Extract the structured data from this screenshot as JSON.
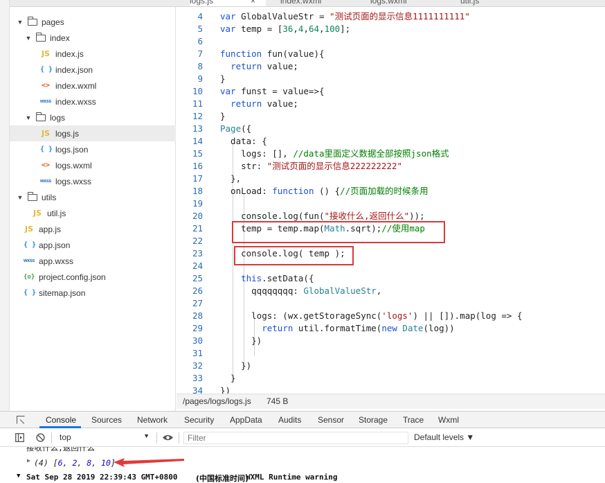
{
  "tabs": [
    {
      "label": "logs.js",
      "active": true,
      "close": "×"
    },
    {
      "label": "index.wxml",
      "active": false
    },
    {
      "label": "logs.wxml",
      "active": false
    },
    {
      "label": "util.js",
      "active": false
    }
  ],
  "tree": [
    {
      "type": "folder",
      "label": "pages",
      "expanded": true,
      "depth": 0
    },
    {
      "type": "folder",
      "label": "index",
      "expanded": true,
      "depth": 1
    },
    {
      "type": "js",
      "label": "index.js",
      "depth": 2
    },
    {
      "type": "json",
      "label": "index.json",
      "depth": 2
    },
    {
      "type": "wxml",
      "label": "index.wxml",
      "depth": 2
    },
    {
      "type": "wxss",
      "label": "index.wxss",
      "depth": 2
    },
    {
      "type": "folder",
      "label": "logs",
      "expanded": true,
      "depth": 1
    },
    {
      "type": "js",
      "label": "logs.js",
      "depth": 2,
      "selected": true
    },
    {
      "type": "json",
      "label": "logs.json",
      "depth": 2
    },
    {
      "type": "wxml",
      "label": "logs.wxml",
      "depth": 2
    },
    {
      "type": "wxss",
      "label": "logs.wxss",
      "depth": 2
    },
    {
      "type": "folder",
      "label": "utils",
      "expanded": true,
      "depth": 0
    },
    {
      "type": "js",
      "label": "util.js",
      "depth": 1
    },
    {
      "type": "js",
      "label": "app.js",
      "depth": 0
    },
    {
      "type": "json",
      "label": "app.json",
      "depth": 0
    },
    {
      "type": "wxss",
      "label": "app.wxss",
      "depth": 0
    },
    {
      "type": "cfg",
      "label": "project.config.json",
      "depth": 0
    },
    {
      "type": "json",
      "label": "sitemap.json",
      "depth": 0
    }
  ],
  "icons": {
    "js": "JS",
    "json": "{ }",
    "wxml": "<>",
    "wxss": "wxss",
    "cfg": "{o}",
    "caret_open": "▼",
    "close": "×",
    "dropdown": "▼",
    "eye": "eye-icon",
    "block": "block-icon"
  },
  "code_lines": [
    {
      "n": "4",
      "html": "<span class=\"kw\">var</span> GlobalValueStr = <span class=\"str\">\"测试页面的显示信息1111111111\"</span>"
    },
    {
      "n": "5",
      "html": "<span class=\"kw\">var</span> temp = [<span class=\"num\">36</span>,<span class=\"num\">4</span>,<span class=\"num\">64</span>,<span class=\"num\">100</span>];"
    },
    {
      "n": "6",
      "html": ""
    },
    {
      "n": "7",
      "html": "<span class=\"kw\">function</span> fun(value){"
    },
    {
      "n": "8",
      "html": "  <span class=\"kw\">return</span> value;"
    },
    {
      "n": "9",
      "html": "}"
    },
    {
      "n": "10",
      "html": "<span class=\"kw\">var</span> funst = value=>{"
    },
    {
      "n": "11",
      "html": "  <span class=\"kw\">return</span> value;"
    },
    {
      "n": "12",
      "html": "}"
    },
    {
      "n": "13",
      "html": "<span class=\"typ\">Page</span>({"
    },
    {
      "n": "14",
      "html": "  data: {"
    },
    {
      "n": "15",
      "html": "    logs: [], <span class=\"cm\">//data里面定义数据全部按照json格式</span>"
    },
    {
      "n": "16",
      "html": "    str: <span class=\"str\">\"测试页面的显示信息222222222\"</span>"
    },
    {
      "n": "17",
      "html": "  },"
    },
    {
      "n": "18",
      "html": "  onLoad: <span class=\"kw\">function</span> () {<span class=\"cm\">//页面加载的时候条用</span>"
    },
    {
      "n": "19",
      "html": ""
    },
    {
      "n": "20",
      "html": "    console.log(fun(<span class=\"str\">\"接收什么,返回什么\"</span>));"
    },
    {
      "n": "21",
      "html": "    temp = temp.map(<span class=\"typ\">Math</span>.sqrt);<span class=\"cm\">//使用map</span>"
    },
    {
      "n": "22",
      "html": ""
    },
    {
      "n": "23",
      "html": "    console.log( temp );"
    },
    {
      "n": "24",
      "html": ""
    },
    {
      "n": "25",
      "html": "    <span class=\"kw\">this</span>.setData({"
    },
    {
      "n": "26",
      "html": "      qqqqqqqq: <span class=\"typ\">GlobalValueStr</span>,"
    },
    {
      "n": "27",
      "html": ""
    },
    {
      "n": "28",
      "html": "      logs: (wx.getStorageSync(<span class=\"str\">'logs'</span>) || []).map(log => {"
    },
    {
      "n": "29",
      "html": "        <span class=\"kw\">return</span> util.formatTime(<span class=\"kw\">new</span> <span class=\"typ\">Date</span>(log))"
    },
    {
      "n": "30",
      "html": "      })"
    },
    {
      "n": "31",
      "html": ""
    },
    {
      "n": "32",
      "html": "    })"
    },
    {
      "n": "33",
      "html": "  }"
    },
    {
      "n": "34",
      "html": "})"
    }
  ],
  "status": {
    "path": "/pages/logs/logs.js",
    "size": "745 B"
  },
  "devtools": {
    "tabs": [
      "Console",
      "Sources",
      "Network",
      "Security",
      "AppData",
      "Audits",
      "Sensor",
      "Storage",
      "Trace",
      "Wxml"
    ],
    "active_tab": "Console",
    "context": "top",
    "filter_placeholder": "Filter",
    "levels": "Default levels ▼"
  },
  "console": {
    "cut_line": "接收什么,返回什么",
    "array_count": "(4)",
    "array_values": [
      "6",
      "2",
      "8",
      "10"
    ],
    "warning_date": "Sat Sep 28 2019 22:39:43 GMT+0800",
    "warning_tz": "(中国标准时间)",
    "warning_text": "WXML Runtime warning"
  },
  "colors": {
    "highlight_box": "#d73a3a",
    "active_tab_underline": "#1a73e8"
  }
}
